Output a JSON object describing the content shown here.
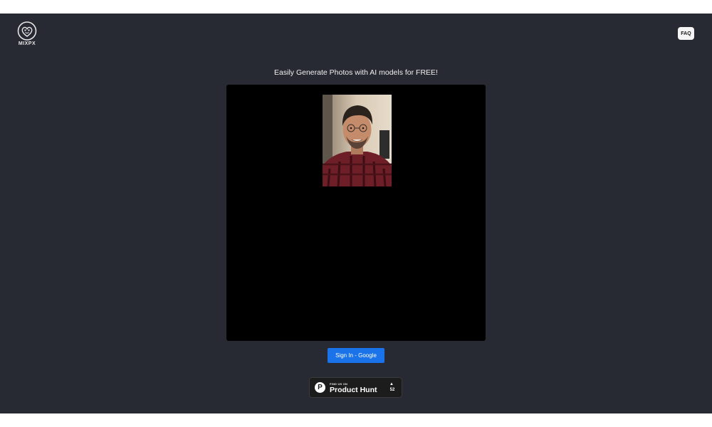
{
  "header": {
    "logo_text": "MIXPX",
    "faq_label": "FAQ"
  },
  "main": {
    "headline": "Easily Generate Photos with AI models for FREE!",
    "signin_label": "Sign In - Google"
  },
  "product_hunt": {
    "small_text": "FIND US ON",
    "name": "Product Hunt",
    "upvote_arrow": "▲",
    "upvote_count": "52"
  },
  "colors": {
    "background": "#282a33",
    "panel": "#000000",
    "accent": "#1a73e8"
  },
  "icons": {
    "logo": "heart-face-logo-icon",
    "product_hunt": "product-hunt-p-icon",
    "upvote": "upvote-triangle-icon"
  }
}
